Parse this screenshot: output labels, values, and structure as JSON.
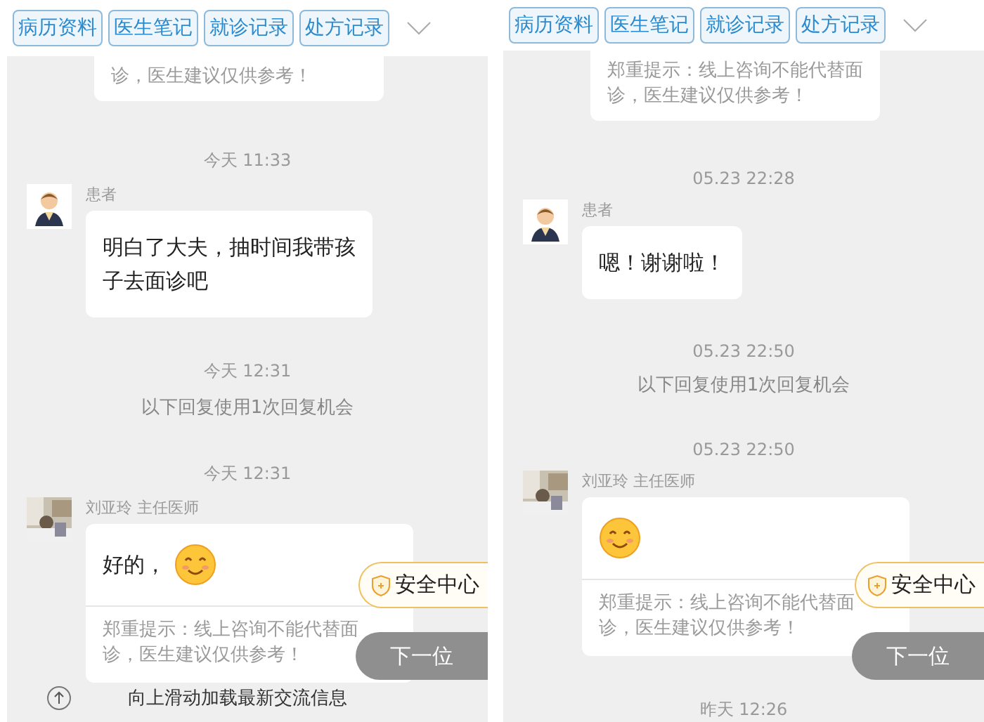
{
  "panels": [
    {
      "tabs": [
        {
          "label": "病历资料"
        },
        {
          "label": "医生笔记"
        },
        {
          "label": "就诊记录"
        },
        {
          "label": "处方记录"
        }
      ],
      "top_notice": "诊，医生建议仅供参考！",
      "items": [
        {
          "kind": "time",
          "text": "今天 11:33"
        },
        {
          "kind": "patient",
          "sender": "患者",
          "text": "明白了大夫，抽时间我带孩子去面诊吧"
        },
        {
          "kind": "time",
          "text": "今天 12:31"
        },
        {
          "kind": "system",
          "text": "以下回复使用1次回复机会"
        },
        {
          "kind": "time",
          "text": "今天 12:31"
        },
        {
          "kind": "doctor",
          "sender": "刘亚玲 主任医师",
          "text": "好的，",
          "emoji": true,
          "notice": "郑重提示：线上咨询不能代替面诊，医生建议仅供参考！"
        },
        {
          "kind": "footer",
          "text": "向上滑动加载最新交流信息"
        }
      ],
      "safety_badge": "安全中心",
      "next_button": "下一位"
    },
    {
      "tabs": [
        {
          "label": "病历资料"
        },
        {
          "label": "医生笔记"
        },
        {
          "label": "就诊记录"
        },
        {
          "label": "处方记录"
        }
      ],
      "top_notice": "郑重提示：线上咨询不能代替面诊，医生建议仅供参考！",
      "items": [
        {
          "kind": "time",
          "text": "05.23 22:28"
        },
        {
          "kind": "patient",
          "sender": "患者",
          "text": "嗯！谢谢啦！"
        },
        {
          "kind": "time",
          "text": "05.23 22:50"
        },
        {
          "kind": "system",
          "text": "以下回复使用1次回复机会"
        },
        {
          "kind": "time",
          "text": "05.23 22:50"
        },
        {
          "kind": "doctor",
          "sender": "刘亚玲 主任医师",
          "emoji": true,
          "notice": "郑重提示：线上咨询不能代替面诊，医生建议仅供参考！"
        },
        {
          "kind": "time",
          "text": "昨天 12:26"
        }
      ],
      "safety_badge": "安全中心",
      "next_button": "下一位"
    }
  ]
}
